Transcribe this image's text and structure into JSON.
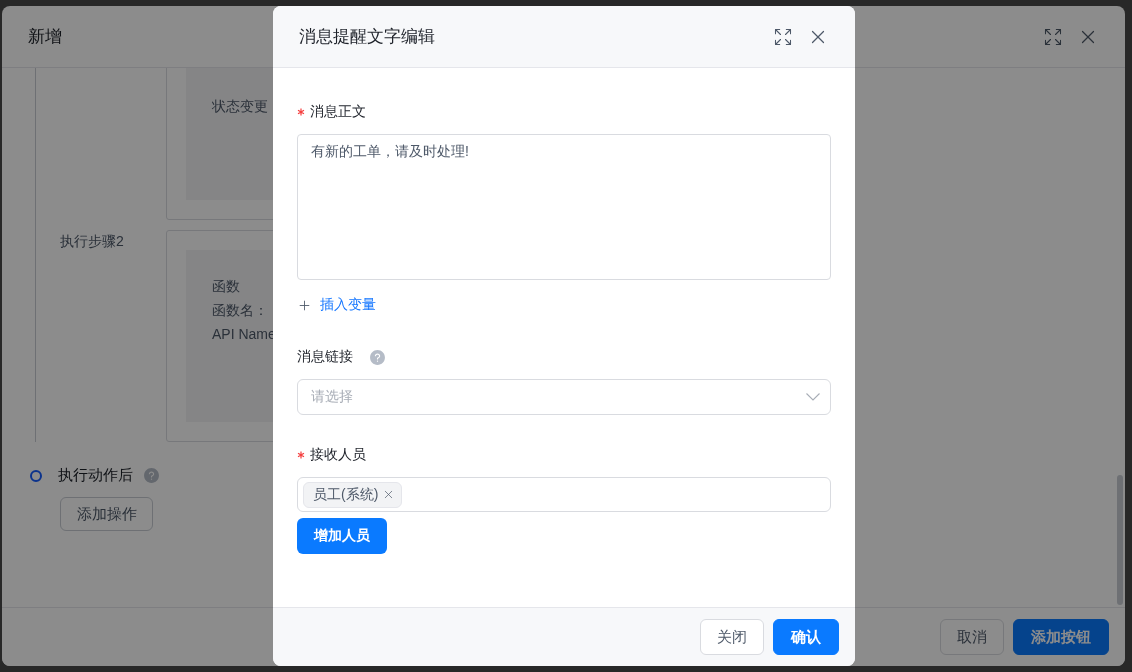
{
  "background_dialog": {
    "title": "新增",
    "steps": [
      {
        "lines": [
          "状态变更"
        ]
      },
      {
        "label": "执行步骤2",
        "lines": [
          "函数",
          "函数名：",
          "API Name"
        ]
      }
    ],
    "after_action": {
      "label": "执行动作后",
      "help": true,
      "button": "添加操作"
    },
    "buttons": [
      {
        "label": "取消",
        "kind": "default"
      },
      {
        "label": "添加按钮",
        "kind": "primary"
      }
    ]
  },
  "modal": {
    "title": "消息提醒文字编辑",
    "message_body": {
      "label": "消息正文",
      "required": true,
      "value": "有新的工单，请及时处理!"
    },
    "insert_variable": "插入变量",
    "message_link": {
      "label": "消息链接",
      "help": true,
      "required": false,
      "placeholder": "请选择"
    },
    "recipients": {
      "label": "接收人员",
      "required": true,
      "tags": [
        {
          "label": "员工(系统)"
        }
      ],
      "add_button": "增加人员"
    },
    "buttons": [
      {
        "label": "关闭",
        "kind": "default"
      },
      {
        "label": "确认",
        "kind": "primary"
      }
    ]
  }
}
